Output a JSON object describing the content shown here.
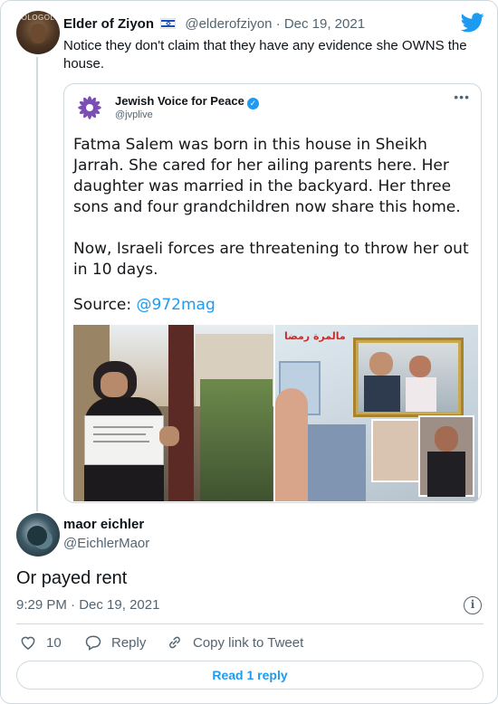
{
  "tweet": {
    "author_name": "Elder of Ziyon",
    "author_handle": "@elderofziyon",
    "separator": "·",
    "date": "Dec 19, 2021",
    "text": "Notice they don't claim that they have any evidence she OWNS the house.",
    "avatar_caption": "OLOGOL"
  },
  "quoted": {
    "author_name": "Jewish Voice for Peace",
    "author_handle": "@jvplive",
    "paragraph1": "Fatma Salem was born in this house in Sheikh Jarrah. She cared for her ailing parents here. Her daughter was married in the backyard. Her three sons and four grandchildren now share this home.",
    "paragraph2": "Now, Israeli forces are threatening to throw her out in 10 days.",
    "source_label": "Source:",
    "source_link": "@972mag",
    "photo_sign_text": "مالمرة رمضا"
  },
  "reply": {
    "author_name": "maor eichler",
    "author_handle": "@EichlerMaor",
    "text": "Or payed rent",
    "time": "9:29 PM",
    "separator": "·",
    "date": "Dec 19, 2021"
  },
  "actions": {
    "like_count": "10",
    "reply_label": "Reply",
    "copy_link_label": "Copy link to Tweet"
  },
  "read_replies_label": "Read 1 reply",
  "colors": {
    "twitter_blue": "#1d9bf0",
    "muted_text": "#536471",
    "border": "#cfd9de",
    "jvp_purple": "#7b4fb5"
  },
  "icons": [
    "twitter-bird-icon",
    "israel-flag-icon",
    "verified-badge-icon",
    "more-icon",
    "heart-icon",
    "reply-icon",
    "link-icon",
    "info-icon"
  ]
}
